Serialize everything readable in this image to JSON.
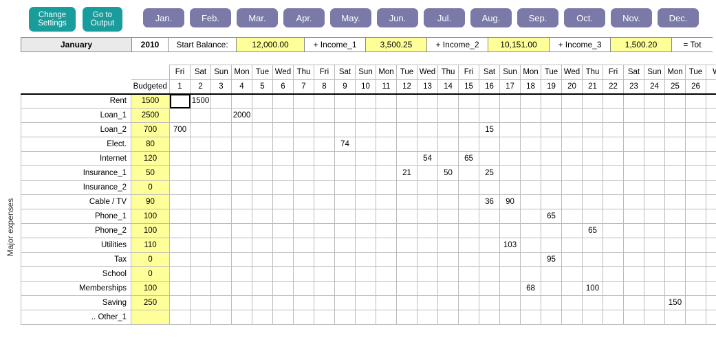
{
  "buttons": {
    "change_settings": "Change\nSettings",
    "goto_output": "Go to\nOutput"
  },
  "months": [
    "Jan.",
    "Feb.",
    "Mar.",
    "Apr.",
    "May.",
    "Jun.",
    "Jul.",
    "Aug.",
    "Sep.",
    "Oct.",
    "Nov.",
    "Dec."
  ],
  "bar": {
    "month_name": "January",
    "year": "2010",
    "start_lbl": "Start Balance:",
    "start_val": "12,000.00",
    "inc1_lbl": "+ Income_1",
    "inc1_val": "3,500.25",
    "inc2_lbl": "+ Income_2",
    "inc2_val": "10,151.00",
    "inc3_lbl": "+ Income_3",
    "inc3_val": "1,500.20",
    "tot_lbl": "= Tot"
  },
  "budgeted_label": "Budgeted",
  "side_label": "Major expenses",
  "dows": [
    "Fri",
    "Sat",
    "Sun",
    "Mon",
    "Tue",
    "Wed",
    "Thu",
    "Fri",
    "Sat",
    "Sun",
    "Mon",
    "Tue",
    "Wed",
    "Thu",
    "Fri",
    "Sat",
    "Sun",
    "Mon",
    "Tue",
    "Wed",
    "Thu",
    "Fri",
    "Sat",
    "Sun",
    "Mon",
    "Tue",
    "W"
  ],
  "daynums": [
    "1",
    "2",
    "3",
    "4",
    "5",
    "6",
    "7",
    "8",
    "9",
    "10",
    "11",
    "12",
    "13",
    "14",
    "15",
    "16",
    "17",
    "18",
    "19",
    "20",
    "21",
    "22",
    "23",
    "24",
    "25",
    "26",
    ""
  ],
  "rows": [
    {
      "name": "Rent",
      "budget": "1500",
      "cells": {
        "2": "1500"
      }
    },
    {
      "name": "Loan_1",
      "budget": "2500",
      "cells": {
        "4": "2000"
      }
    },
    {
      "name": "Loan_2",
      "budget": "700",
      "cells": {
        "1": "700",
        "16": "15"
      }
    },
    {
      "name": "Elect.",
      "budget": "80",
      "cells": {
        "9": "74"
      }
    },
    {
      "name": "Internet",
      "budget": "120",
      "cells": {
        "13": "54",
        "15": "65"
      }
    },
    {
      "name": "Insurance_1",
      "budget": "50",
      "cells": {
        "12": "21",
        "14": "50",
        "16": "25"
      }
    },
    {
      "name": "Insurance_2",
      "budget": "0",
      "cells": {}
    },
    {
      "name": "Cable / TV",
      "budget": "90",
      "cells": {
        "16": "36",
        "17": "90"
      }
    },
    {
      "name": "Phone_1",
      "budget": "100",
      "cells": {
        "19": "65"
      }
    },
    {
      "name": "Phone_2",
      "budget": "100",
      "cells": {
        "21": "65"
      }
    },
    {
      "name": "Utilities",
      "budget": "110",
      "cells": {
        "17": "103"
      }
    },
    {
      "name": "Tax",
      "budget": "0",
      "cells": {
        "19": "95"
      }
    },
    {
      "name": "School",
      "budget": "0",
      "cells": {}
    },
    {
      "name": "Memberships",
      "budget": "100",
      "cells": {
        "18": "68",
        "21": "100"
      }
    },
    {
      "name": "Saving",
      "budget": "250",
      "cells": {
        "25": "150"
      }
    },
    {
      "name": ".. Other_1",
      "budget": "",
      "cells": {}
    }
  ],
  "selected_cell": {
    "row": 0,
    "day": "1"
  }
}
